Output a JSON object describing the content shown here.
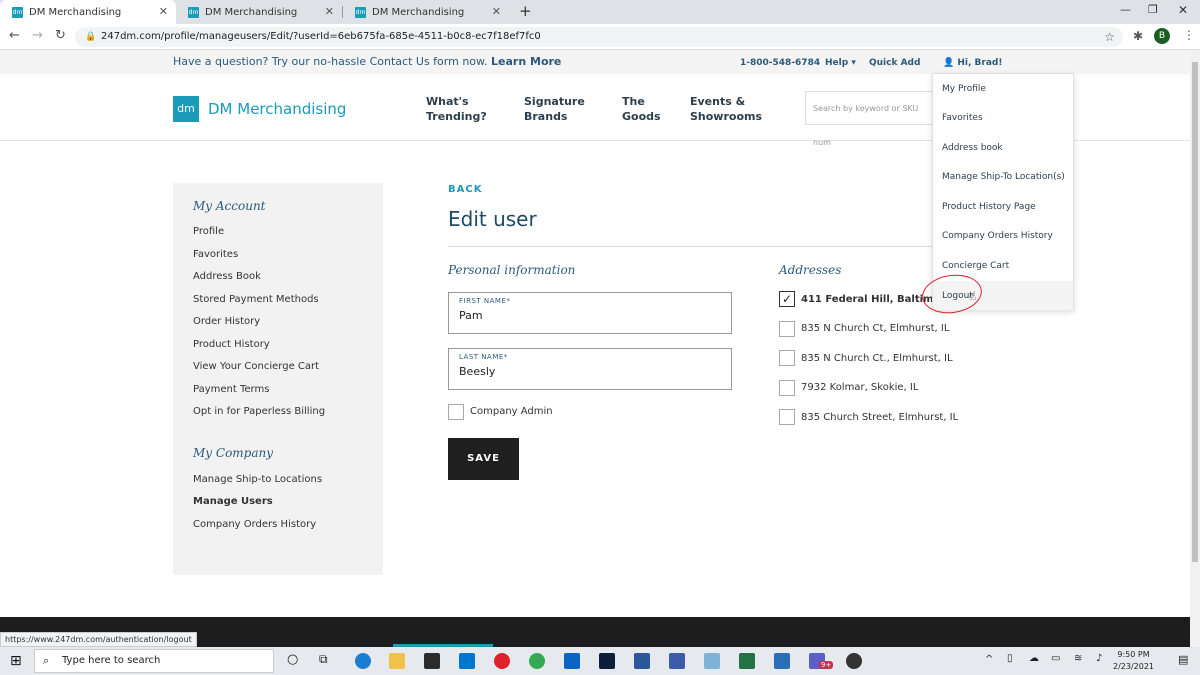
{
  "browser": {
    "tabs": [
      {
        "label": "DM Merchandising",
        "favicon": "dm"
      },
      {
        "label": "DM Merchandising",
        "favicon": "dm"
      },
      {
        "label": "DM Merchandising",
        "favicon": "dm"
      }
    ],
    "url": "247dm.com/profile/manageusers/Edit/?userId=6eb675fa-685e-4511-b0c8-ec7f18ef7fc0",
    "profile_initial": "B",
    "status_url": "https://www.247dm.com/authentication/logout"
  },
  "topbar": {
    "question": "Have a question? Try our no-hassle Contact Us form now.",
    "learn_more": "Learn More",
    "phone": "1-800-548-6784",
    "help": "Help",
    "quick_add": "Quick Add",
    "greeting": "Hi, Brad!"
  },
  "header": {
    "logo_mark": "dm",
    "logo_text": "DM Merchandising",
    "nav": [
      {
        "line1": "What's",
        "line2": "Trending?"
      },
      {
        "line1": "Signature",
        "line2": "Brands"
      },
      {
        "line1": "The",
        "line2": "Goods"
      },
      {
        "line1": "Events &",
        "line2": "Showrooms"
      }
    ],
    "search_placeholder": "Search by keyword or SKU num"
  },
  "sidebar": {
    "account_heading": "My Account",
    "account_items": [
      "Profile",
      "Favorites",
      "Address Book",
      "Stored Payment Methods",
      "Order History",
      "Product History",
      "View Your Concierge Cart",
      "Payment Terms",
      "Opt in for Paperless Billing"
    ],
    "company_heading": "My Company",
    "company_items": [
      "Manage Ship-to Locations",
      "Manage Users",
      "Company Orders History"
    ]
  },
  "main": {
    "back": "BACK",
    "title": "Edit user",
    "personal_heading": "Personal information",
    "first_name_label": "FIRST NAME*",
    "first_name": "Pam",
    "last_name_label": "LAST NAME*",
    "last_name": "Beesly",
    "company_admin": "Company Admin",
    "save": "SAVE",
    "addresses_heading": "Addresses",
    "addresses": [
      {
        "label": "411 Federal Hill, Baltimo",
        "checked": true
      },
      {
        "label": "835 N Church Ct, Elmhurst, IL",
        "checked": false
      },
      {
        "label": "835 N Church Ct., Elmhurst, IL",
        "checked": false
      },
      {
        "label": "7932 Kolmar, Skokie, IL",
        "checked": false
      },
      {
        "label": "835 Church Street, Elmhurst, IL",
        "checked": false
      }
    ]
  },
  "dropdown": {
    "items": [
      "My Profile",
      "Favorites",
      "Address book",
      "Manage Ship-To Location(s)",
      "Product History Page",
      "Company Orders History",
      "Concierge Cart",
      "Logout"
    ]
  },
  "taskbar": {
    "search_placeholder": "Type here to search",
    "time": "9:50 PM",
    "date": "2/23/2021",
    "badge": "9+"
  },
  "colors": {
    "brand": "#1a9bb7",
    "heading": "#2c5a7a",
    "annotation": "#e0202a"
  }
}
